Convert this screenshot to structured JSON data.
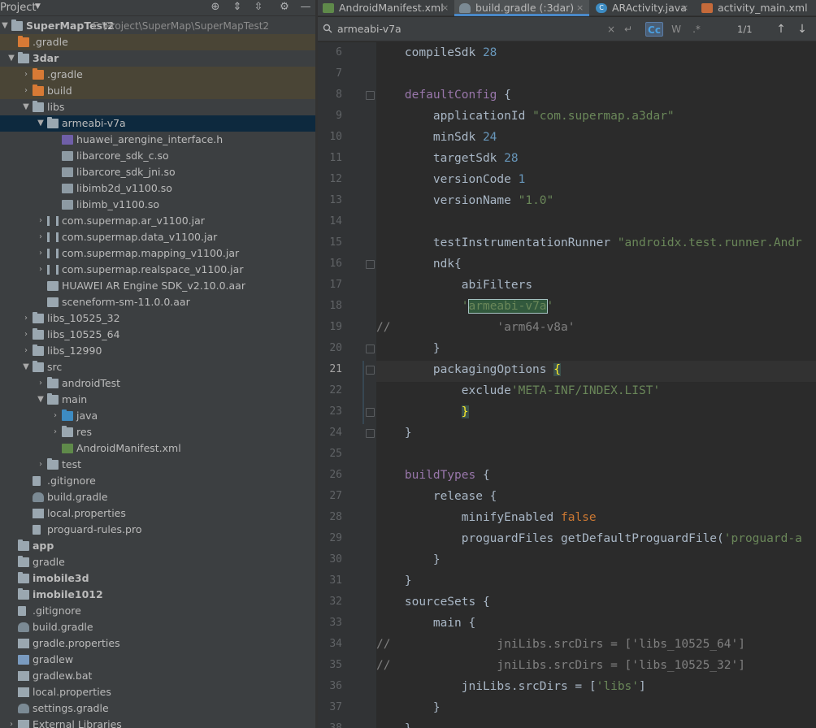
{
  "project_panel": {
    "title": "Project",
    "tree": [
      {
        "label": "SuperMapTest2",
        "path": "E:\\Project\\SuperMap\\SuperMapTest2",
        "bold": true
      },
      {
        "label": ".gradle"
      },
      {
        "label": "3dar",
        "bold": true
      },
      {
        "label": ".gradle"
      },
      {
        "label": "build"
      },
      {
        "label": "libs"
      },
      {
        "label": "armeabi-v7a"
      },
      {
        "label": "huawei_arengine_interface.h"
      },
      {
        "label": "libarcore_sdk_c.so"
      },
      {
        "label": "libarcore_sdk_jni.so"
      },
      {
        "label": "libimb2d_v1100.so"
      },
      {
        "label": "libimb_v1100.so"
      },
      {
        "label": "com.supermap.ar_v1100.jar"
      },
      {
        "label": "com.supermap.data_v1100.jar"
      },
      {
        "label": "com.supermap.mapping_v1100.jar"
      },
      {
        "label": "com.supermap.realspace_v1100.jar"
      },
      {
        "label": "HUAWEI AR Engine SDK_v2.10.0.aar"
      },
      {
        "label": "sceneform-sm-11.0.0.aar"
      },
      {
        "label": "libs_10525_32"
      },
      {
        "label": "libs_10525_64"
      },
      {
        "label": "libs_12990"
      },
      {
        "label": "src"
      },
      {
        "label": "androidTest"
      },
      {
        "label": "main"
      },
      {
        "label": "java"
      },
      {
        "label": "res"
      },
      {
        "label": "AndroidManifest.xml"
      },
      {
        "label": "test"
      },
      {
        "label": ".gitignore"
      },
      {
        "label": "build.gradle"
      },
      {
        "label": "local.properties"
      },
      {
        "label": "proguard-rules.pro"
      },
      {
        "label": "app",
        "bold": true
      },
      {
        "label": "gradle"
      },
      {
        "label": "imobile3d",
        "bold": true
      },
      {
        "label": "imobile1012",
        "bold": true
      },
      {
        "label": ".gitignore"
      },
      {
        "label": "build.gradle"
      },
      {
        "label": "gradle.properties"
      },
      {
        "label": "gradlew"
      },
      {
        "label": "gradlew.bat"
      },
      {
        "label": "local.properties"
      },
      {
        "label": "settings.gradle"
      },
      {
        "label": "External Libraries"
      }
    ]
  },
  "tabs": [
    {
      "label": "AndroidManifest.xml",
      "icon": "MF"
    },
    {
      "label": "build.gradle (:3dar)",
      "icon": "gradle",
      "active": true
    },
    {
      "label": "ARActivity.java",
      "icon": "C"
    },
    {
      "label": "activity_main.xml",
      "icon": "xml"
    }
  ],
  "search": {
    "query": "armeabi-v7a",
    "match_case": "Cc",
    "words": "W",
    "regex": ".*",
    "count": "1/1"
  },
  "editor": {
    "current_line": "21",
    "lines": [
      {
        "n": "6",
        "parts": [
          [
            "    compileSdk ",
            ""
          ],
          [
            "28",
            "k-num"
          ]
        ]
      },
      {
        "n": "7",
        "parts": []
      },
      {
        "n": "8",
        "parts": [
          [
            "    ",
            ""
          ],
          [
            "defaultConfig",
            "k-purple"
          ],
          [
            " {",
            ""
          ]
        ]
      },
      {
        "n": "9",
        "parts": [
          [
            "        applicationId ",
            ""
          ],
          [
            "\"com.supermap.a3dar\"",
            "k-str"
          ]
        ]
      },
      {
        "n": "10",
        "parts": [
          [
            "        minSdk ",
            ""
          ],
          [
            "24",
            "k-num"
          ]
        ]
      },
      {
        "n": "11",
        "parts": [
          [
            "        targetSdk ",
            ""
          ],
          [
            "28",
            "k-num"
          ]
        ]
      },
      {
        "n": "12",
        "parts": [
          [
            "        versionCode ",
            ""
          ],
          [
            "1",
            "k-num"
          ]
        ]
      },
      {
        "n": "13",
        "parts": [
          [
            "        versionName ",
            ""
          ],
          [
            "\"1.0\"",
            "k-str"
          ]
        ]
      },
      {
        "n": "14",
        "parts": []
      },
      {
        "n": "15",
        "parts": [
          [
            "        testInstrumentationRunner ",
            ""
          ],
          [
            "\"androidx.test.runner.Andr",
            "k-str"
          ]
        ]
      },
      {
        "n": "16",
        "parts": [
          [
            "        ndk{",
            ""
          ]
        ]
      },
      {
        "n": "17",
        "parts": [
          [
            "            abiFilters",
            ""
          ]
        ]
      },
      {
        "n": "18",
        "parts": [
          [
            "            ",
            ""
          ],
          [
            "'",
            "k-str"
          ],
          [
            "armeabi-v7a",
            "k-str match-box"
          ],
          [
            "'",
            "k-str"
          ]
        ]
      },
      {
        "n": "19",
        "parts": [
          [
            "//               ",
            "k-cmt"
          ],
          [
            "'arm64-v8a'",
            "k-cmt"
          ]
        ]
      },
      {
        "n": "20",
        "parts": [
          [
            "        }",
            ""
          ]
        ]
      },
      {
        "n": "21",
        "parts": [
          [
            "        packagingOptions ",
            ""
          ],
          [
            "{",
            "brace-hl"
          ]
        ]
      },
      {
        "n": "22",
        "parts": [
          [
            "            exclude",
            ""
          ],
          [
            "'META-INF/INDEX.LIST'",
            "k-str"
          ]
        ]
      },
      {
        "n": "23",
        "parts": [
          [
            "            ",
            ""
          ],
          [
            "}",
            "brace-hl"
          ]
        ]
      },
      {
        "n": "24",
        "parts": [
          [
            "    }",
            ""
          ]
        ]
      },
      {
        "n": "25",
        "parts": []
      },
      {
        "n": "26",
        "parts": [
          [
            "    ",
            ""
          ],
          [
            "buildTypes",
            "k-purple"
          ],
          [
            " {",
            ""
          ]
        ]
      },
      {
        "n": "27",
        "parts": [
          [
            "        release {",
            ""
          ]
        ]
      },
      {
        "n": "28",
        "parts": [
          [
            "            minifyEnabled ",
            ""
          ],
          [
            "false",
            "k-orange"
          ]
        ]
      },
      {
        "n": "29",
        "parts": [
          [
            "            proguardFiles getDefaultProguardFile(",
            ""
          ],
          [
            "'proguard-a",
            "k-str"
          ]
        ]
      },
      {
        "n": "30",
        "parts": [
          [
            "        }",
            ""
          ]
        ]
      },
      {
        "n": "31",
        "parts": [
          [
            "    }",
            ""
          ]
        ]
      },
      {
        "n": "32",
        "parts": [
          [
            "    sourceSets {",
            ""
          ]
        ]
      },
      {
        "n": "33",
        "parts": [
          [
            "        main {",
            ""
          ]
        ]
      },
      {
        "n": "34",
        "parts": [
          [
            "//               jniLibs.srcDirs = ['libs_10525_64']",
            "k-cmt"
          ]
        ]
      },
      {
        "n": "35",
        "parts": [
          [
            "//               jniLibs.srcDirs = ['libs_10525_32']",
            "k-cmt"
          ]
        ]
      },
      {
        "n": "36",
        "parts": [
          [
            "            jniLibs.srcDirs = [",
            ""
          ],
          [
            "'libs'",
            "k-str"
          ],
          [
            "]",
            ""
          ]
        ]
      },
      {
        "n": "37",
        "parts": [
          [
            "        }",
            ""
          ]
        ]
      },
      {
        "n": "38",
        "parts": [
          [
            "    }",
            ""
          ]
        ]
      }
    ]
  }
}
